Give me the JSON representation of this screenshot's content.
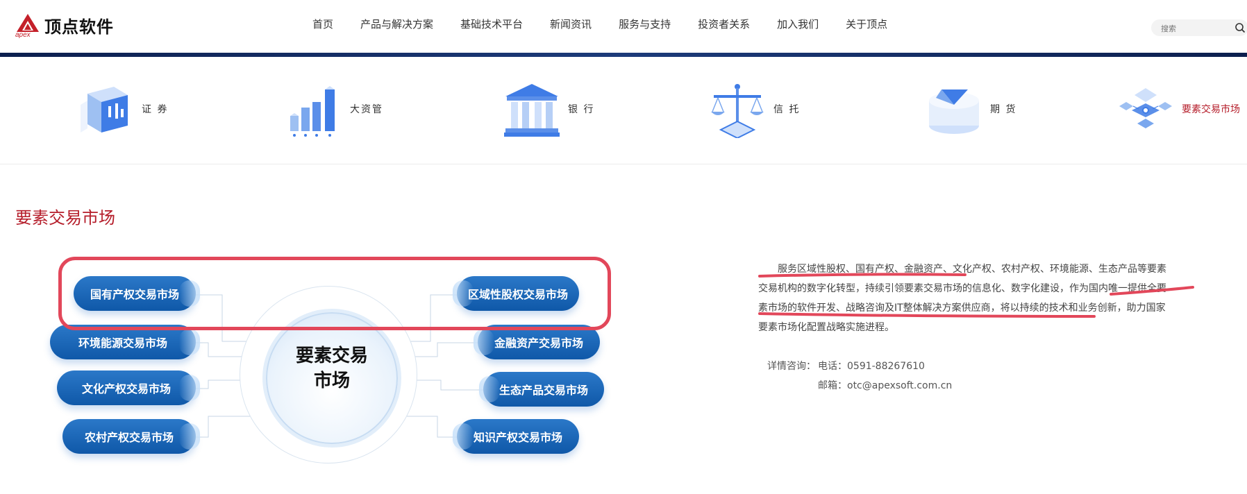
{
  "logo": {
    "brand": "apex",
    "text": "顶点软件"
  },
  "nav": [
    "首页",
    "产品与解决方案",
    "基础技术平台",
    "新闻资讯",
    "服务与支持",
    "投资者关系",
    "加入我们",
    "关于顶点"
  ],
  "search": {
    "placeholder": "搜索"
  },
  "categories": [
    "证 券",
    "大资管",
    "银 行",
    "信 托",
    "期 货",
    "要素交易市场"
  ],
  "active_category": "要素交易市场",
  "section": {
    "title": "要素交易市场"
  },
  "diagram": {
    "center": [
      "要素交易",
      "市场"
    ],
    "left": [
      "国有产权交易市场",
      "环境能源交易市场",
      "文化产权交易市场",
      "农村产权交易市场"
    ],
    "right": [
      "区域性股权交易市场",
      "金融资产交易市场",
      "生态产品交易市场",
      "知识产权交易市场"
    ]
  },
  "intro": "服务区域性股权、国有产权、金融资产、文化产权、农村产权、环境能源、生态产品等要素交易机构的数字化转型，持续引领要素交易市场的信息化、数字化建设，作为国内唯一提供全要素市场的软件开发、战略咨询及IT整体解决方案供应商，将以持续的技术和业务创新，助力国家要素市场化配置战略实施进程。",
  "contact": {
    "label": "详情咨询：",
    "phone": "电话：0591-88267610",
    "email": "邮箱：otc@apexsoft.com.cn"
  },
  "colors": {
    "accent": "#b51d2a",
    "pill": "#1560b0",
    "annotation": "#e2475a"
  }
}
